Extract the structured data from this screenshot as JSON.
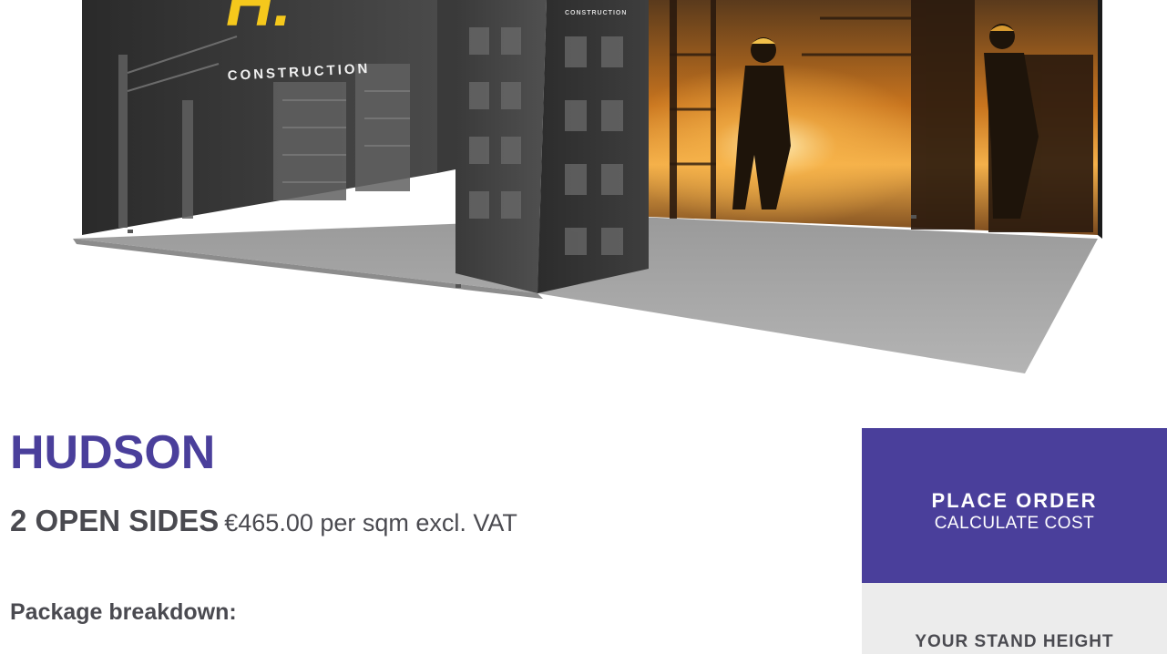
{
  "hero": {
    "logo_letters": "H.",
    "logo_word": "CONSTRUCTION",
    "tower_word": "CONSTRUCTION"
  },
  "product": {
    "title": "HUDSON",
    "sides_label": "2 OPEN SIDES",
    "price_text": "€465.00 per sqm excl. VAT",
    "breakdown_heading": "Package breakdown:"
  },
  "order": {
    "title": "PLACE ORDER",
    "subtitle": "CALCULATE COST",
    "height_label": "YOUR STAND HEIGHT"
  },
  "colors": {
    "brand_purple": "#4a3f9b",
    "text_gray": "#4a4a50",
    "logo_yellow": "#f5c81c",
    "panel_gray": "#ececec"
  }
}
